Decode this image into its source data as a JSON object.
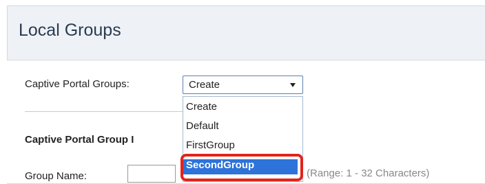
{
  "page": {
    "title": "Local Groups"
  },
  "form": {
    "captive_portal_groups_label": "Captive Portal Groups:",
    "captive_portal_groups_value": "Create",
    "section_title": "Captive Portal Group I",
    "group_name_label": "Group Name:",
    "group_name_hint": "(Range: 1 - 32 Characters)"
  },
  "dropdown": {
    "options": [
      "Create",
      "Default",
      "FirstGroup",
      "SecondGroup"
    ],
    "selected": "SecondGroup"
  },
  "colors": {
    "accent": "#2d73d9",
    "highlight": "#e3231b"
  }
}
